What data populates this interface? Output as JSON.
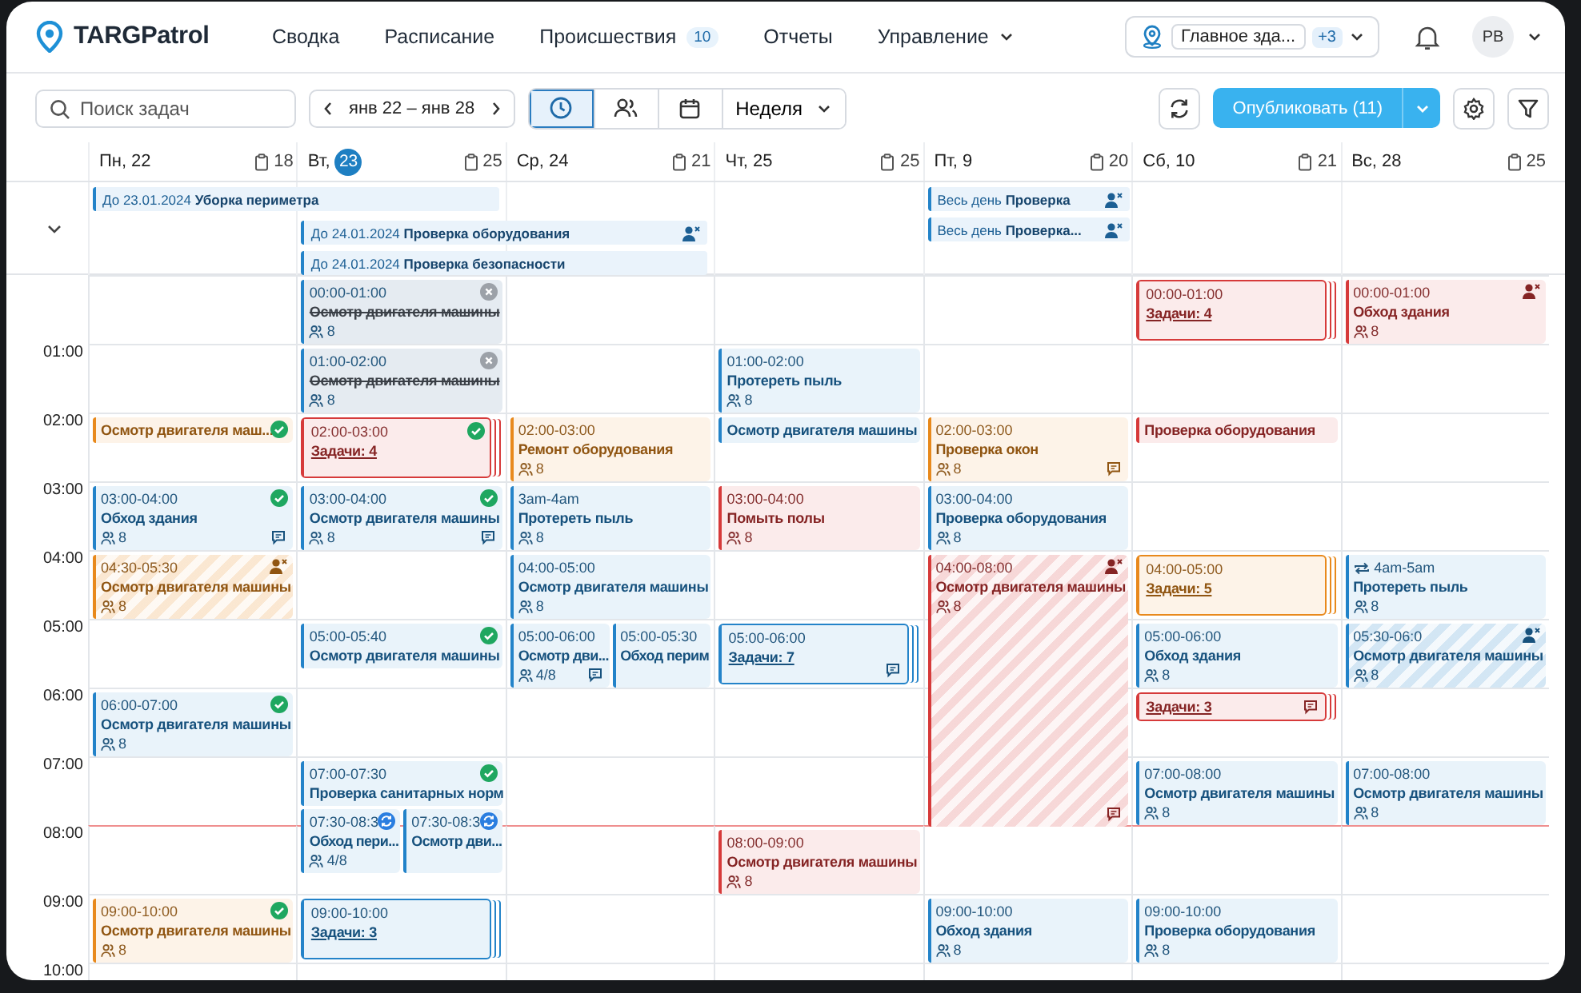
{
  "app": {
    "name": "TARGPatrol"
  },
  "nav": [
    {
      "label": "Сводка",
      "dropdown": false
    },
    {
      "label": "Расписание",
      "dropdown": false
    },
    {
      "label": "Происшествия",
      "badge": "10",
      "dropdown": false
    },
    {
      "label": "Отчеты",
      "dropdown": false
    },
    {
      "label": "Управление",
      "dropdown": true
    }
  ],
  "location": {
    "name": "Главное зда...",
    "extra": "+3"
  },
  "user": {
    "initials": "PB"
  },
  "toolbar": {
    "search": {
      "placeholder": "Поиск задач"
    },
    "range": "янв 22 – янв 28",
    "views": [
      {
        "kind": "clock",
        "selected": true
      },
      {
        "kind": "people",
        "selected": false
      },
      {
        "kind": "calendar",
        "selected": false
      }
    ],
    "period": "Неделя",
    "publish": "Опубликовать (11)"
  },
  "days": [
    {
      "weekday": "Пн,",
      "date": "22",
      "today": false,
      "count": "18",
      "allday": [
        {
          "kind": "span2",
          "text": "До 23.01.2024 **Уборка периметра**"
        }
      ]
    },
    {
      "weekday": "Вт,",
      "date": "23",
      "today": true,
      "count": "25",
      "allday": [
        {
          "kind": "span2",
          "text": "До 24.01.2024 **Проверка оборудования**",
          "badge": {
            "kind": "unassigned"
          }
        },
        {
          "kind": "span2",
          "text": "До 24.01.2024 **Проверка безопасности**"
        }
      ]
    },
    {
      "weekday": "Ср,",
      "date": "24",
      "today": false,
      "count": "21"
    },
    {
      "weekday": "Чт,",
      "date": "25",
      "today": false,
      "count": "25"
    },
    {
      "weekday": "Пт,",
      "date": "9",
      "today": false,
      "count": "20",
      "allday": [
        {
          "kind": "single",
          "text": "Весь день **Проверка**",
          "badge": {
            "kind": "unassigned"
          }
        },
        {
          "kind": "single",
          "text": "Весь день **Проверка...**",
          "badge": {
            "kind": "unassigned"
          }
        }
      ]
    },
    {
      "weekday": "Сб,",
      "date": "10",
      "today": false,
      "count": "21"
    },
    {
      "weekday": "Вс,",
      "date": "28",
      "today": false,
      "count": "25"
    }
  ],
  "rows": [
    {
      "now": false,
      "cells": [
        {},
        {
          "events": [
            {
              "kind": "single",
              "color": "#2383c9",
              "time": "00:00-01:00",
              "title": "Осмотр двигателя машины",
              "count": "8",
              "badge": {
                "kind": "cancelled"
              },
              "comment": false,
              "striped": false
            }
          ]
        },
        {},
        {},
        {},
        {
          "events": [
            {
              "kind": "group",
              "color": "#d63a3a",
              "time": "00:00-01:00",
              "title": "Задачи: 4",
              "comment": false,
              "striped": false
            }
          ]
        },
        {
          "events": [
            {
              "kind": "single",
              "color": "#d63a3a",
              "time": "00:00-01:00",
              "title": "Обход здания",
              "count": "8",
              "badge": {
                "kind": "unassigned"
              },
              "comment": false,
              "striped": false
            }
          ]
        }
      ]
    },
    {
      "label": "01:00",
      "now": false,
      "cells": [
        {},
        {
          "events": [
            {
              "kind": "single",
              "color": "#2383c9",
              "time": "01:00-02:00",
              "title": "Осмотр двигателя машины",
              "count": "8",
              "badge": {
                "kind": "cancelled"
              },
              "comment": false,
              "striped": false
            }
          ]
        },
        {},
        {
          "events": [
            {
              "kind": "single",
              "color": "#2383c9",
              "time": "01:00-02:00",
              "title": "Протереть пыль",
              "count": "8",
              "comment": false,
              "striped": false
            }
          ]
        },
        {},
        {},
        {}
      ]
    },
    {
      "label": "02:00",
      "now": false,
      "cells": [
        {
          "events": [
            {
              "kind": "single",
              "color": "#e8891c",
              "title": "Осмотр двигателя маш...",
              "badge": {
                "kind": "done"
              },
              "comment": false,
              "striped": false
            }
          ]
        },
        {
          "events": [
            {
              "kind": "group",
              "color": "#d63a3a",
              "time": "02:00-03:00",
              "title": "Задачи: 4",
              "badge": {
                "kind": "done"
              },
              "comment": false,
              "striped": false
            }
          ]
        },
        {
          "events": [
            {
              "kind": "single",
              "color": "#e8891c",
              "time": "02:00-03:00",
              "title": "Ремонт оборудования",
              "count": "8",
              "comment": false,
              "striped": false
            }
          ]
        },
        {
          "events": [
            {
              "kind": "single",
              "color": "#2383c9",
              "title": "Осмотр двигателя машины",
              "comment": false,
              "striped": false
            }
          ]
        },
        {
          "events": [
            {
              "kind": "single",
              "color": "#e8891c",
              "time": "02:00-03:00",
              "title": "Проверка окон",
              "count": "8",
              "comment": true,
              "striped": false
            }
          ]
        },
        {
          "events": [
            {
              "kind": "single",
              "color": "#d63a3a",
              "title": "Проверка оборудования",
              "comment": false,
              "striped": false
            }
          ]
        },
        {}
      ]
    },
    {
      "label": "03:00",
      "now": false,
      "cells": [
        {
          "events": [
            {
              "kind": "single",
              "color": "#2383c9",
              "time": "03:00-04:00",
              "title": "Обход здания",
              "count": "8",
              "badge": {
                "kind": "done"
              },
              "comment": true,
              "striped": false
            }
          ]
        },
        {
          "events": [
            {
              "kind": "single",
              "color": "#2383c9",
              "time": "03:00-04:00",
              "title": "Осмотр двигателя машины",
              "count": "8",
              "badge": {
                "kind": "done"
              },
              "comment": true,
              "striped": false
            }
          ]
        },
        {
          "events": [
            {
              "kind": "single",
              "color": "#2383c9",
              "time": "3am-4am",
              "title": "Протереть пыль",
              "count": "8",
              "comment": false,
              "striped": false
            }
          ]
        },
        {
          "events": [
            {
              "kind": "single",
              "color": "#d63a3a",
              "time": "03:00-04:00",
              "title": "Помыть полы",
              "count": "8",
              "comment": false,
              "striped": false
            }
          ]
        },
        {
          "events": [
            {
              "kind": "single",
              "color": "#2383c9",
              "time": "03:00-04:00",
              "title": "Проверка оборудования",
              "count": "8",
              "comment": false,
              "striped": false
            }
          ]
        },
        {},
        {}
      ]
    },
    {
      "label": "04:00",
      "now": false,
      "cells": [
        {
          "events": [
            {
              "kind": "single",
              "color": "#e8891c",
              "time": "04:30-05:30",
              "title": "Осмотр двигателя машины",
              "count": "8",
              "badge": {
                "kind": "unassigned"
              },
              "comment": false,
              "striped": true
            }
          ]
        },
        {},
        {
          "events": [
            {
              "kind": "single",
              "color": "#2383c9",
              "time": "04:00-05:00",
              "title": "Осмотр двигателя машины",
              "count": "8",
              "comment": false,
              "striped": false
            }
          ]
        },
        {},
        {
          "events": [
            {
              "kind": "long",
              "color": "#d63a3a",
              "time": "04:00-08:00",
              "title": "Осмотр двигателя машины",
              "count": "8",
              "badge": {
                "kind": "unassigned"
              },
              "comment": true,
              "striped": true
            }
          ]
        },
        {
          "events": [
            {
              "kind": "group",
              "color": "#e8891c",
              "time": "04:00-05:00",
              "title": "Задачи: 5",
              "comment": false,
              "striped": false
            }
          ]
        },
        {
          "events": [
            {
              "kind": "single",
              "color": "#2383c9",
              "time": "4am-5am",
              "title": "Протереть пыль",
              "count": "8",
              "badge": {
                "kind": "repeat"
              },
              "comment": false,
              "striped": false
            }
          ]
        }
      ]
    },
    {
      "label": "05:00",
      "now": false,
      "cells": [
        {},
        {
          "events": [
            {
              "kind": "single",
              "color": "#2383c9",
              "time": "05:00-05:40",
              "title": "Осмотр двигателя машины",
              "badge": {
                "kind": "done"
              },
              "comment": false,
              "striped": false
            }
          ]
        },
        {
          "events": [
            {
              "kind": "half",
              "color": "#2383c9",
              "time": "05:00-06:00",
              "title": "Осмотр дви...",
              "count": "4/8",
              "comment": true,
              "striped": false
            },
            {
              "kind": "half",
              "color": "#2383c9",
              "time": "05:00-05:30",
              "title": "Обход перим",
              "comment": false,
              "striped": false
            }
          ]
        },
        {
          "events": [
            {
              "kind": "group",
              "color": "#2383c9",
              "time": "05:00-06:00",
              "title": "Задачи: 7",
              "comment": true,
              "striped": false
            }
          ]
        },
        {},
        {
          "events": [
            {
              "kind": "single",
              "color": "#2383c9",
              "time": "05:00-06:00",
              "title": "Обход здания",
              "count": "8",
              "comment": false,
              "striped": false
            }
          ]
        },
        {
          "events": [
            {
              "kind": "single",
              "color": "#2383c9",
              "time": "05:30-06:0",
              "title": "Осмотр двигателя машины",
              "count": "8",
              "badge": {
                "kind": "unassigned"
              },
              "comment": false,
              "striped": true
            }
          ]
        }
      ]
    },
    {
      "label": "06:00",
      "now": false,
      "cells": [
        {
          "events": [
            {
              "kind": "single",
              "color": "#2383c9",
              "time": "06:00-07:00",
              "title": "Осмотр двигателя машины",
              "count": "8",
              "badge": {
                "kind": "done"
              },
              "comment": false,
              "striped": false
            }
          ]
        },
        {},
        {},
        {},
        {},
        {
          "events": [
            {
              "kind": "group",
              "color": "#d63a3a",
              "title": "Задачи: 3",
              "comment": true,
              "striped": false
            }
          ]
        },
        {}
      ]
    },
    {
      "label": "07:00",
      "now": false,
      "cells": [
        {},
        {
          "events": [
            {
              "kind": "single",
              "color": "#2383c9",
              "time": "07:00-07:30",
              "title": "Проверка санитарных норм",
              "badge": {
                "kind": "done"
              },
              "comment": false,
              "striped": false
            },
            {
              "kind": "half",
              "color": "#2383c9",
              "time": "07:30-08:3",
              "title": "Обход пери...",
              "count": "4/8",
              "badge": {
                "kind": "sync"
              },
              "comment": false,
              "striped": false
            },
            {
              "kind": "half",
              "color": "#2383c9",
              "time": "07:30-08:3",
              "title": "Осмотр дви...",
              "badge": {
                "kind": "sync"
              },
              "comment": false,
              "striped": false
            }
          ]
        },
        {},
        {},
        {},
        {
          "events": [
            {
              "kind": "single",
              "color": "#2383c9",
              "time": "07:00-08:00",
              "title": "Осмотр двигателя машины",
              "count": "8",
              "comment": false,
              "striped": false
            }
          ]
        },
        {
          "events": [
            {
              "kind": "single",
              "color": "#2383c9",
              "time": "07:00-08:00",
              "title": "Осмотр двигателя машины",
              "count": "8",
              "comment": false,
              "striped": false
            }
          ]
        }
      ]
    },
    {
      "label": "08:00",
      "now": true,
      "cells": [
        {},
        {},
        {},
        {
          "events": [
            {
              "kind": "single",
              "color": "#d63a3a",
              "time": "08:00-09:00",
              "title": "Осмотр двигателя машины",
              "count": "8",
              "comment": false,
              "striped": false
            }
          ]
        },
        {},
        {},
        {}
      ]
    },
    {
      "label": "09:00",
      "now": false,
      "cells": [
        {
          "events": [
            {
              "kind": "single",
              "color": "#e8891c",
              "time": "09:00-10:00",
              "title": "Осмотр двигателя машины",
              "count": "8",
              "badge": {
                "kind": "done"
              },
              "comment": false,
              "striped": false
            }
          ]
        },
        {
          "events": [
            {
              "kind": "group",
              "color": "#2383c9",
              "time": "09:00-10:00",
              "title": "Задачи: 3",
              "comment": false,
              "striped": false
            }
          ]
        },
        {},
        {},
        {
          "events": [
            {
              "kind": "single",
              "color": "#2383c9",
              "time": "09:00-10:00",
              "title": "Обход здания",
              "count": "8",
              "comment": false,
              "striped": false
            }
          ]
        },
        {
          "events": [
            {
              "kind": "single",
              "color": "#2383c9",
              "time": "09:00-10:00",
              "title": "Проверка оборудования",
              "count": "8",
              "comment": false,
              "striped": false
            }
          ]
        },
        {}
      ]
    },
    {
      "label": "10:00",
      "now": false,
      "cells": [
        {},
        {},
        {},
        {},
        {},
        {},
        {}
      ]
    }
  ]
}
